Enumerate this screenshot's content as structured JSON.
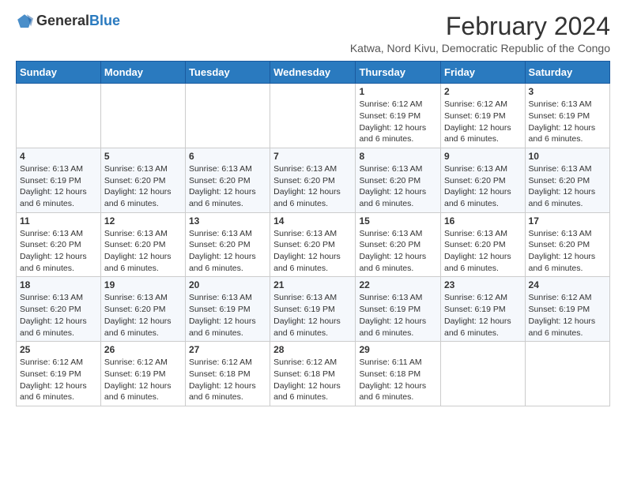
{
  "logo": {
    "general": "General",
    "blue": "Blue"
  },
  "title": {
    "month_year": "February 2024",
    "location": "Katwa, Nord Kivu, Democratic Republic of the Congo"
  },
  "days_of_week": [
    "Sunday",
    "Monday",
    "Tuesday",
    "Wednesday",
    "Thursday",
    "Friday",
    "Saturday"
  ],
  "weeks": [
    [
      {
        "day": "",
        "info": ""
      },
      {
        "day": "",
        "info": ""
      },
      {
        "day": "",
        "info": ""
      },
      {
        "day": "",
        "info": ""
      },
      {
        "day": "1",
        "info": "Sunrise: 6:12 AM\nSunset: 6:19 PM\nDaylight: 12 hours and 6 minutes."
      },
      {
        "day": "2",
        "info": "Sunrise: 6:12 AM\nSunset: 6:19 PM\nDaylight: 12 hours and 6 minutes."
      },
      {
        "day": "3",
        "info": "Sunrise: 6:13 AM\nSunset: 6:19 PM\nDaylight: 12 hours and 6 minutes."
      }
    ],
    [
      {
        "day": "4",
        "info": "Sunrise: 6:13 AM\nSunset: 6:19 PM\nDaylight: 12 hours and 6 minutes."
      },
      {
        "day": "5",
        "info": "Sunrise: 6:13 AM\nSunset: 6:20 PM\nDaylight: 12 hours and 6 minutes."
      },
      {
        "day": "6",
        "info": "Sunrise: 6:13 AM\nSunset: 6:20 PM\nDaylight: 12 hours and 6 minutes."
      },
      {
        "day": "7",
        "info": "Sunrise: 6:13 AM\nSunset: 6:20 PM\nDaylight: 12 hours and 6 minutes."
      },
      {
        "day": "8",
        "info": "Sunrise: 6:13 AM\nSunset: 6:20 PM\nDaylight: 12 hours and 6 minutes."
      },
      {
        "day": "9",
        "info": "Sunrise: 6:13 AM\nSunset: 6:20 PM\nDaylight: 12 hours and 6 minutes."
      },
      {
        "day": "10",
        "info": "Sunrise: 6:13 AM\nSunset: 6:20 PM\nDaylight: 12 hours and 6 minutes."
      }
    ],
    [
      {
        "day": "11",
        "info": "Sunrise: 6:13 AM\nSunset: 6:20 PM\nDaylight: 12 hours and 6 minutes."
      },
      {
        "day": "12",
        "info": "Sunrise: 6:13 AM\nSunset: 6:20 PM\nDaylight: 12 hours and 6 minutes."
      },
      {
        "day": "13",
        "info": "Sunrise: 6:13 AM\nSunset: 6:20 PM\nDaylight: 12 hours and 6 minutes."
      },
      {
        "day": "14",
        "info": "Sunrise: 6:13 AM\nSunset: 6:20 PM\nDaylight: 12 hours and 6 minutes."
      },
      {
        "day": "15",
        "info": "Sunrise: 6:13 AM\nSunset: 6:20 PM\nDaylight: 12 hours and 6 minutes."
      },
      {
        "day": "16",
        "info": "Sunrise: 6:13 AM\nSunset: 6:20 PM\nDaylight: 12 hours and 6 minutes."
      },
      {
        "day": "17",
        "info": "Sunrise: 6:13 AM\nSunset: 6:20 PM\nDaylight: 12 hours and 6 minutes."
      }
    ],
    [
      {
        "day": "18",
        "info": "Sunrise: 6:13 AM\nSunset: 6:20 PM\nDaylight: 12 hours and 6 minutes."
      },
      {
        "day": "19",
        "info": "Sunrise: 6:13 AM\nSunset: 6:20 PM\nDaylight: 12 hours and 6 minutes."
      },
      {
        "day": "20",
        "info": "Sunrise: 6:13 AM\nSunset: 6:19 PM\nDaylight: 12 hours and 6 minutes."
      },
      {
        "day": "21",
        "info": "Sunrise: 6:13 AM\nSunset: 6:19 PM\nDaylight: 12 hours and 6 minutes."
      },
      {
        "day": "22",
        "info": "Sunrise: 6:13 AM\nSunset: 6:19 PM\nDaylight: 12 hours and 6 minutes."
      },
      {
        "day": "23",
        "info": "Sunrise: 6:12 AM\nSunset: 6:19 PM\nDaylight: 12 hours and 6 minutes."
      },
      {
        "day": "24",
        "info": "Sunrise: 6:12 AM\nSunset: 6:19 PM\nDaylight: 12 hours and 6 minutes."
      }
    ],
    [
      {
        "day": "25",
        "info": "Sunrise: 6:12 AM\nSunset: 6:19 PM\nDaylight: 12 hours and 6 minutes."
      },
      {
        "day": "26",
        "info": "Sunrise: 6:12 AM\nSunset: 6:19 PM\nDaylight: 12 hours and 6 minutes."
      },
      {
        "day": "27",
        "info": "Sunrise: 6:12 AM\nSunset: 6:18 PM\nDaylight: 12 hours and 6 minutes."
      },
      {
        "day": "28",
        "info": "Sunrise: 6:12 AM\nSunset: 6:18 PM\nDaylight: 12 hours and 6 minutes."
      },
      {
        "day": "29",
        "info": "Sunrise: 6:11 AM\nSunset: 6:18 PM\nDaylight: 12 hours and 6 minutes."
      },
      {
        "day": "",
        "info": ""
      },
      {
        "day": "",
        "info": ""
      }
    ]
  ]
}
